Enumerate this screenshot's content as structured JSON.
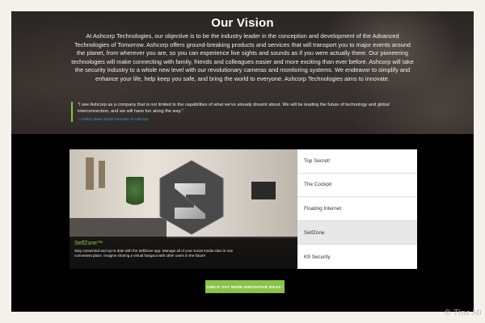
{
  "hero": {
    "title": "Our Vision",
    "body": "At Ashcorp Technologies, our objective is to be the industry leader in the conception and development of the Advanced Technologies of Tomorrow. Ashcorp offers ground-breaking products and services that will transport you to major events around the planet, from wherever you are, so you can experience live sights and sounds as if you were actually there. Our pioneering technologies will make connecting with family, friends and colleagues easier and more exciting than ever before. Ashcorp will take the security industry to a whole new level with our revolutionary cameras and monitoring systems. We endeavor to simplify and enhance your life, help keep you safe, and bring the world to everyone. Ashcorp Technologies aims to innovate.",
    "quote": "\"I see Ashcorp as a company that is not limited to the capabilities of what we've already dreamt about. We will be leading the future of technology and global interconnection, and we will have fun along the way.\"",
    "quote_author": "~ Ashley Brian Smith Founder of Ashcorp"
  },
  "feature": {
    "title": "SelfZone™",
    "description": "Stay connected and up-to-date with the SelfZone app. Manage all of your social media sites in one convenient place. Imagine sharing a virtual hangout with other users in the future!",
    "tabs": [
      {
        "label": "Top Secret!"
      },
      {
        "label": "The Cockpit"
      },
      {
        "label": "Floating Internet"
      },
      {
        "label": "SelfZone"
      },
      {
        "label": "K9 Security"
      }
    ],
    "active_tab": "SelfZone"
  },
  "cta": {
    "label": "CHECK OUT MORE INNOVATIVE IDEAS ›"
  },
  "watermark": "© Tina Mi",
  "colors": {
    "accent": "#8bc34a",
    "link": "#3aa0d8",
    "background": "#f3f1ea"
  }
}
